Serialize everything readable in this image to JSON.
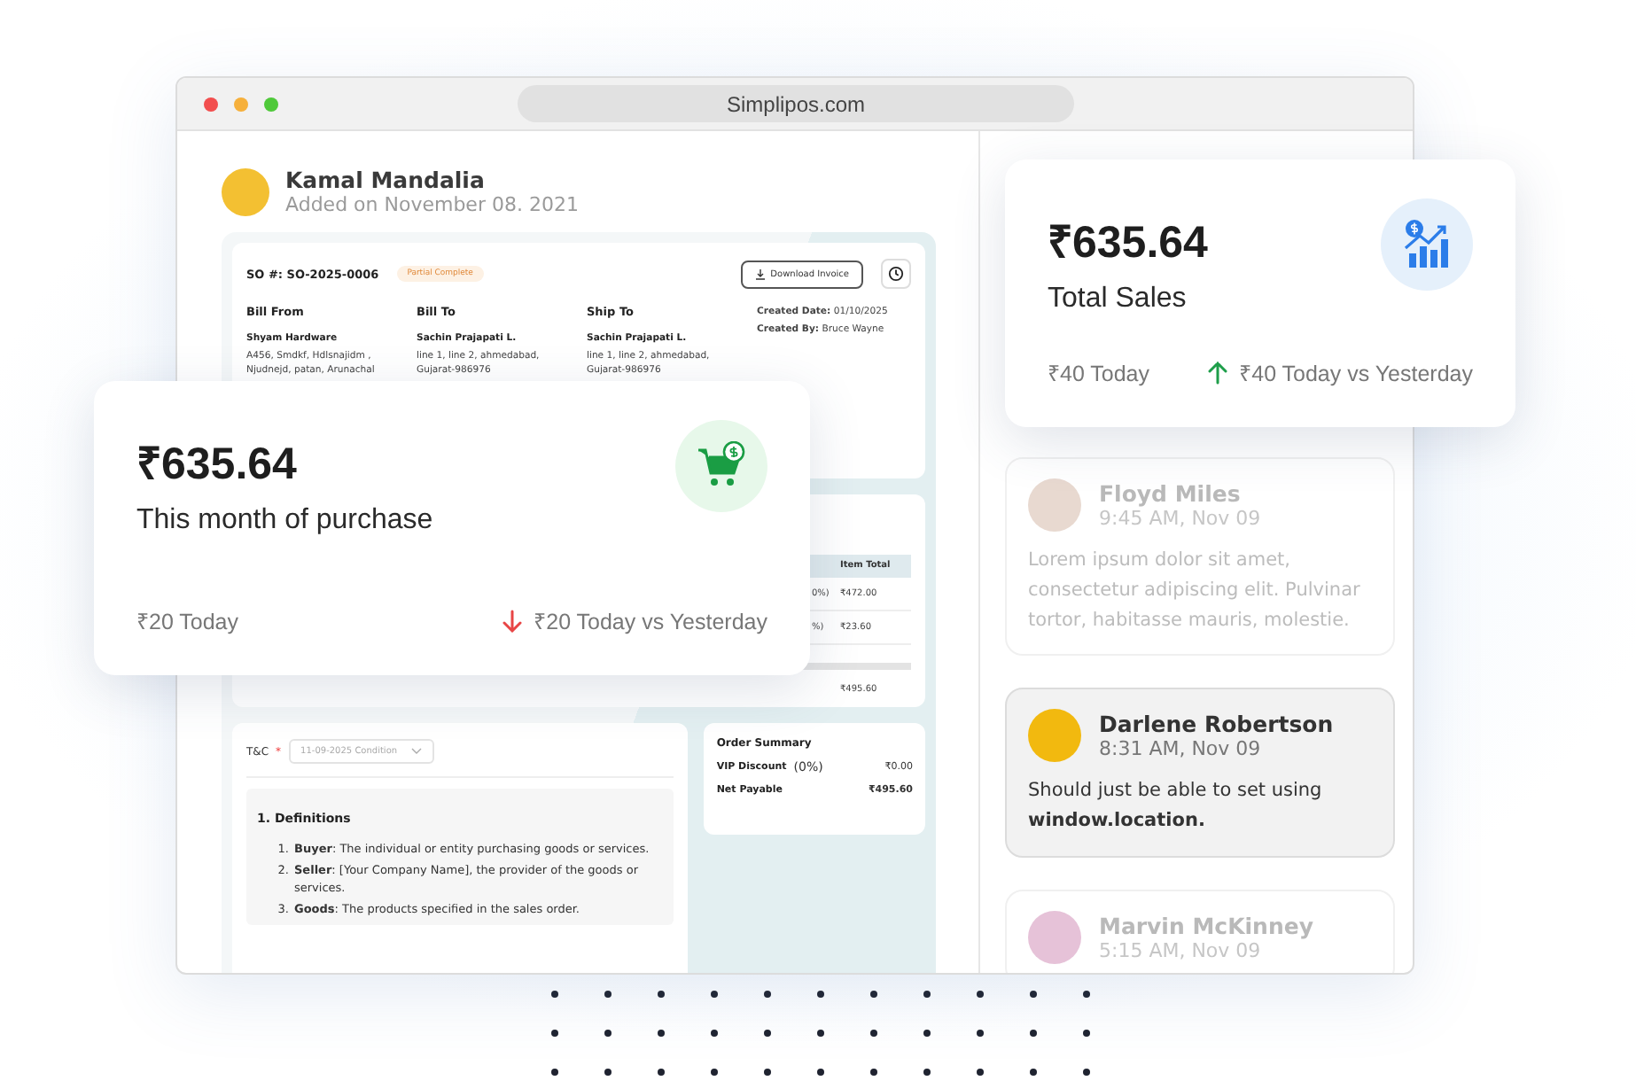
{
  "browser": {
    "url": "Simplipos.com"
  },
  "profile": {
    "name": "Kamal Mandalia",
    "subtitle": "Added on November 08. 2021"
  },
  "invoice": {
    "so_number": "SO #: SO-2025-0006",
    "status_badge": "Partial Complete",
    "download_button": "Download Invoice",
    "parties": [
      {
        "heading": "Bill From",
        "name": "Shyam Hardware",
        "lines": [
          "A456, Smdkf, Hdlsnajidm ,",
          "Njudnejd, patan, Arunachal"
        ]
      },
      {
        "heading": "Bill To",
        "name": "Sachin Prajapati L.",
        "lines": [
          "line 1, line 2, ahmedabad,",
          "Gujarat-986976"
        ]
      },
      {
        "heading": "Ship To",
        "name": "Sachin Prajapati L.",
        "lines": [
          "line 1, line 2, ahmedabad,",
          "Gujarat-986976"
        ]
      }
    ],
    "meta": [
      {
        "label": "Created Date:",
        "value": "01/10/2025"
      },
      {
        "label": "Created By:",
        "value": "Bruce Wayne"
      }
    ]
  },
  "items_table": {
    "columns": [
      "",
      "Item Total"
    ],
    "rows": [
      [
        "0%)",
        "₹472.00"
      ],
      [
        "%)",
        "₹23.60"
      ]
    ],
    "total": "₹495.60"
  },
  "terms": {
    "label": "T&C",
    "required_mark": "*",
    "select_value": "11-09-2025 Condition",
    "heading": "1. Definitions",
    "items": [
      {
        "marker": "1.",
        "text": "**Buyer**: The individual or entity purchasing goods or services."
      },
      {
        "marker": "2.",
        "text": "**Seller**: [Your Company Name], the provider of the goods or services."
      },
      {
        "marker": "3.",
        "text": "**Goods**: The products specified in the sales order."
      }
    ]
  },
  "order_summary": {
    "title": "Order Summary",
    "rows": [
      {
        "label": "VIP Discount",
        "note": "(0%)",
        "value": "₹0.00"
      },
      {
        "label": "Net Payable",
        "value": "₹495.60"
      }
    ]
  },
  "messages": [
    {
      "name": "Floyd Miles",
      "time": "9:45 AM, Nov 09",
      "text": "Lorem ipsum dolor sit amet, consectetur adipiscing elit. Pulvinar tortor, habitasse mauris, molestie.",
      "selected": false,
      "color": "#e8d9d0"
    },
    {
      "name": "Darlene Robertson",
      "time": "8:31 AM, Nov 09",
      "text": "Should just be able to set using **window.location.**",
      "selected": true,
      "color": "#f2b90f"
    },
    {
      "name": "Marvin McKinney",
      "time": "5:15 AM, Nov 09",
      "selected": false,
      "color": "#e6c2d8"
    }
  ],
  "stat_cards": [
    {
      "kind": "purchase",
      "amount": "₹635.64",
      "label": "This month of purchase",
      "today": "₹20 Today",
      "rising": false,
      "comparison": "₹20 Today vs Yesterday"
    },
    {
      "kind": "sales",
      "amount": "₹635.64",
      "label": "Total Sales",
      "today": "₹40 Today",
      "rising": true,
      "comparison": "₹40 Today vs Yesterday"
    }
  ]
}
